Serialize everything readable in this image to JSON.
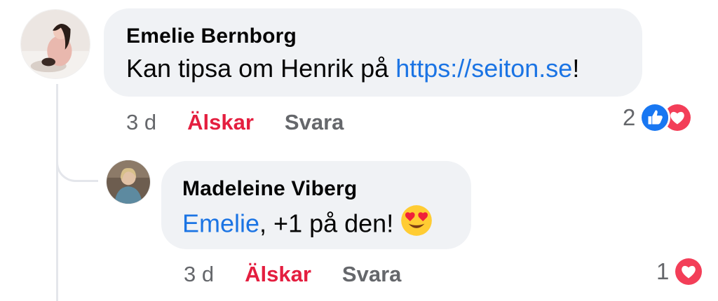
{
  "comments": [
    {
      "author": "Emelie Bernborg",
      "text_before": "Kan tipsa om Henrik på ",
      "link": "https://seiton.se",
      "text_after": "!",
      "time": "3 d",
      "love_label": "Älskar",
      "reply_label": "Svara",
      "reaction_count": "2",
      "reactions": [
        "like-icon",
        "love-icon"
      ]
    },
    {
      "author": "Madeleine Viberg",
      "mention": "Emelie",
      "text_after": ", +1 på den! ",
      "emoji": "heart-eyes-emoji",
      "time": "3 d",
      "love_label": "Älskar",
      "reply_label": "Svara",
      "reaction_count": "1",
      "reactions": [
        "love-icon"
      ]
    }
  ],
  "colors": {
    "bubble": "#f0f2f5",
    "link": "#1b74e4",
    "love": "#e41e3f",
    "like": "#1877f2",
    "muted": "#65676b"
  }
}
